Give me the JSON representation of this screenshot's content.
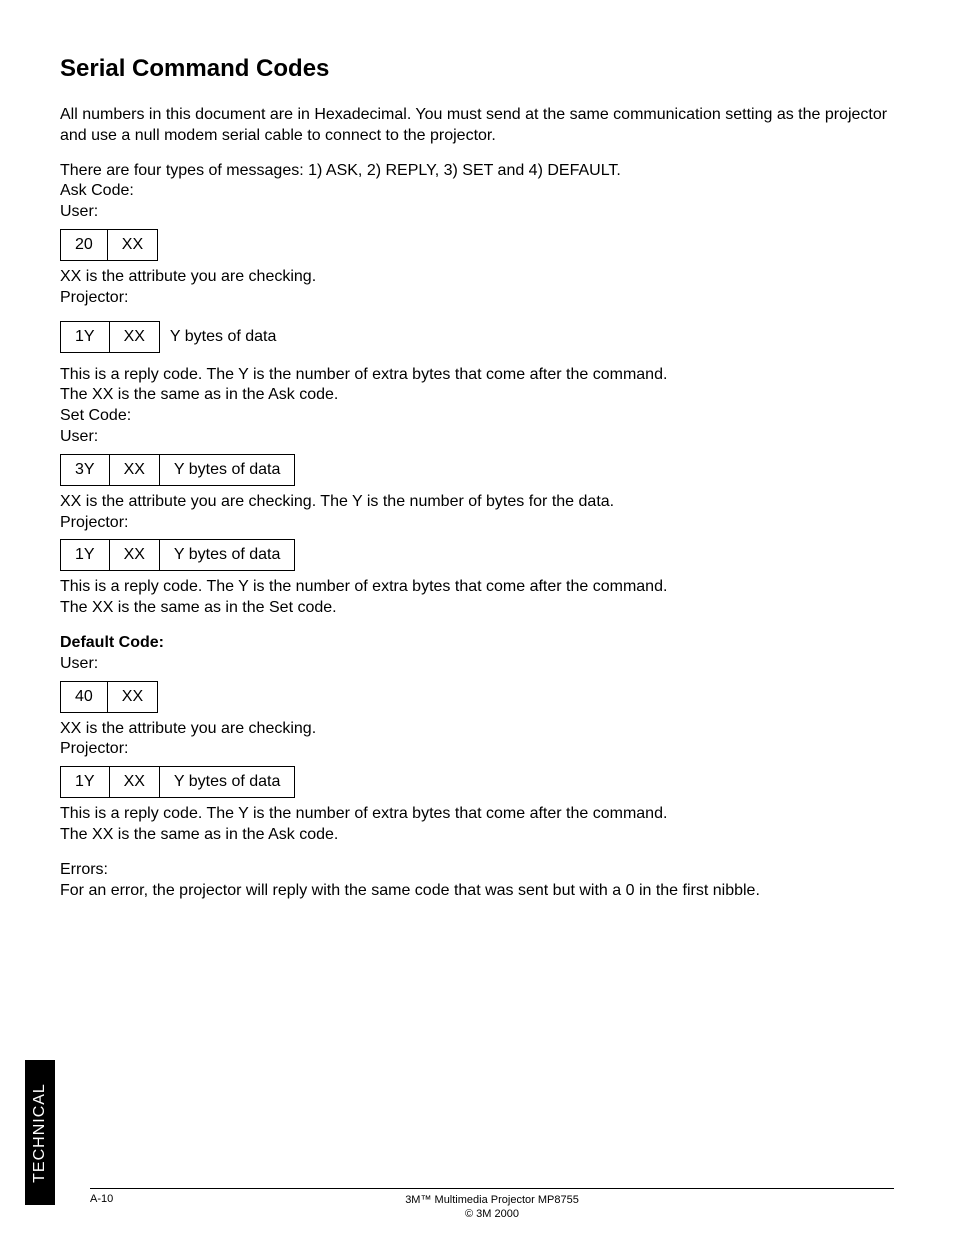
{
  "title": "Serial Command Codes",
  "intro": "All numbers in this document are in Hexadecimal.  You must send at the same communication setting as the projector and use a null modem serial cable to connect to the projector.",
  "messageTypes": "There are four types of messages:  1) ASK, 2) REPLY,  3) SET and 4) DEFAULT.",
  "askCodeLabel": "Ask Code:",
  "userLabel": "User:",
  "projectorLabel": "Projector:",
  "askUser": {
    "c1": "20",
    "c2": "XX"
  },
  "xxCheckingText": "XX is the attribute you are checking.",
  "askProjector": {
    "c1": "1Y",
    "c2": "XX",
    "trailing": "Y bytes of data"
  },
  "replyExplain1": "This is a reply code. The Y is the number of extra bytes that come after the command.",
  "replyExplain2": "The XX is the same as in the Ask code.",
  "setCodeLabel": "Set Code:",
  "setUser": {
    "c1": "3Y",
    "c2": "XX",
    "c3": "Y bytes of data"
  },
  "setExplain": "XX is the attribute you are checking. The Y is the number of bytes for the data.",
  "setProjector": {
    "c1": "1Y",
    "c2": "XX",
    "c3": "Y bytes of data"
  },
  "setReplyExplain1": "This is a reply code.  The Y is the number of extra bytes that come after the command.",
  "setReplyExplain2": "The XX is the same as in the Set code.",
  "defaultCodeLabel": "Default Code:",
  "defaultUser": {
    "c1": "40",
    "c2": "XX"
  },
  "defaultProjector": {
    "c1": "1Y",
    "c2": "XX",
    "c3": "Y bytes of data"
  },
  "defaultReplyExplain1": "This is a reply code.  The Y is the number of extra bytes that come after the command.",
  "defaultReplyExplain2": "The XX is the same as in the Ask code.",
  "errorsLabel": "Errors:",
  "errorsText": "For an error, the projector will reply with the same code that was sent but with a 0 in the first nibble.",
  "sideTab": "TECHNICAL",
  "footer": {
    "pageNum": "A-10",
    "product": "3M™ Multimedia Projector MP8755",
    "copyright": "© 3M 2000"
  }
}
